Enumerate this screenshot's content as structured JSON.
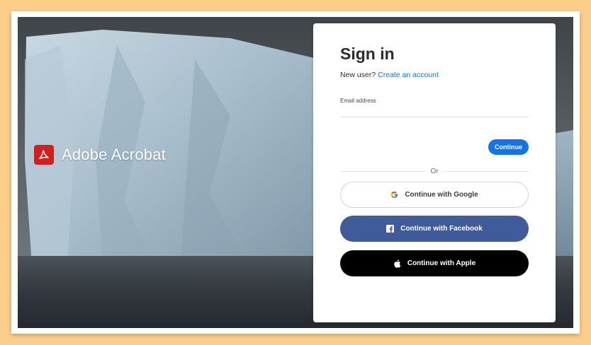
{
  "brand": {
    "name": "Adobe Acrobat",
    "logo_icon": "adobe-acrobat-icon",
    "logo_color": "#d11f1f"
  },
  "signin": {
    "title": "Sign in",
    "new_user_prefix": "New user?",
    "create_account_link": "Create an account",
    "email_label": "Email address",
    "email_value": "",
    "continue_label": "Continue",
    "divider_label": "Or",
    "google_label": "Continue with Google",
    "facebook_label": "Continue with Facebook",
    "apple_label": "Continue with Apple"
  },
  "colors": {
    "accent": "#1473e6",
    "facebook": "#3f5b9a",
    "apple": "#000000",
    "page_background": "#fbcf8a"
  },
  "icons": [
    "adobe-acrobat-icon",
    "google-icon",
    "facebook-icon",
    "apple-icon"
  ]
}
